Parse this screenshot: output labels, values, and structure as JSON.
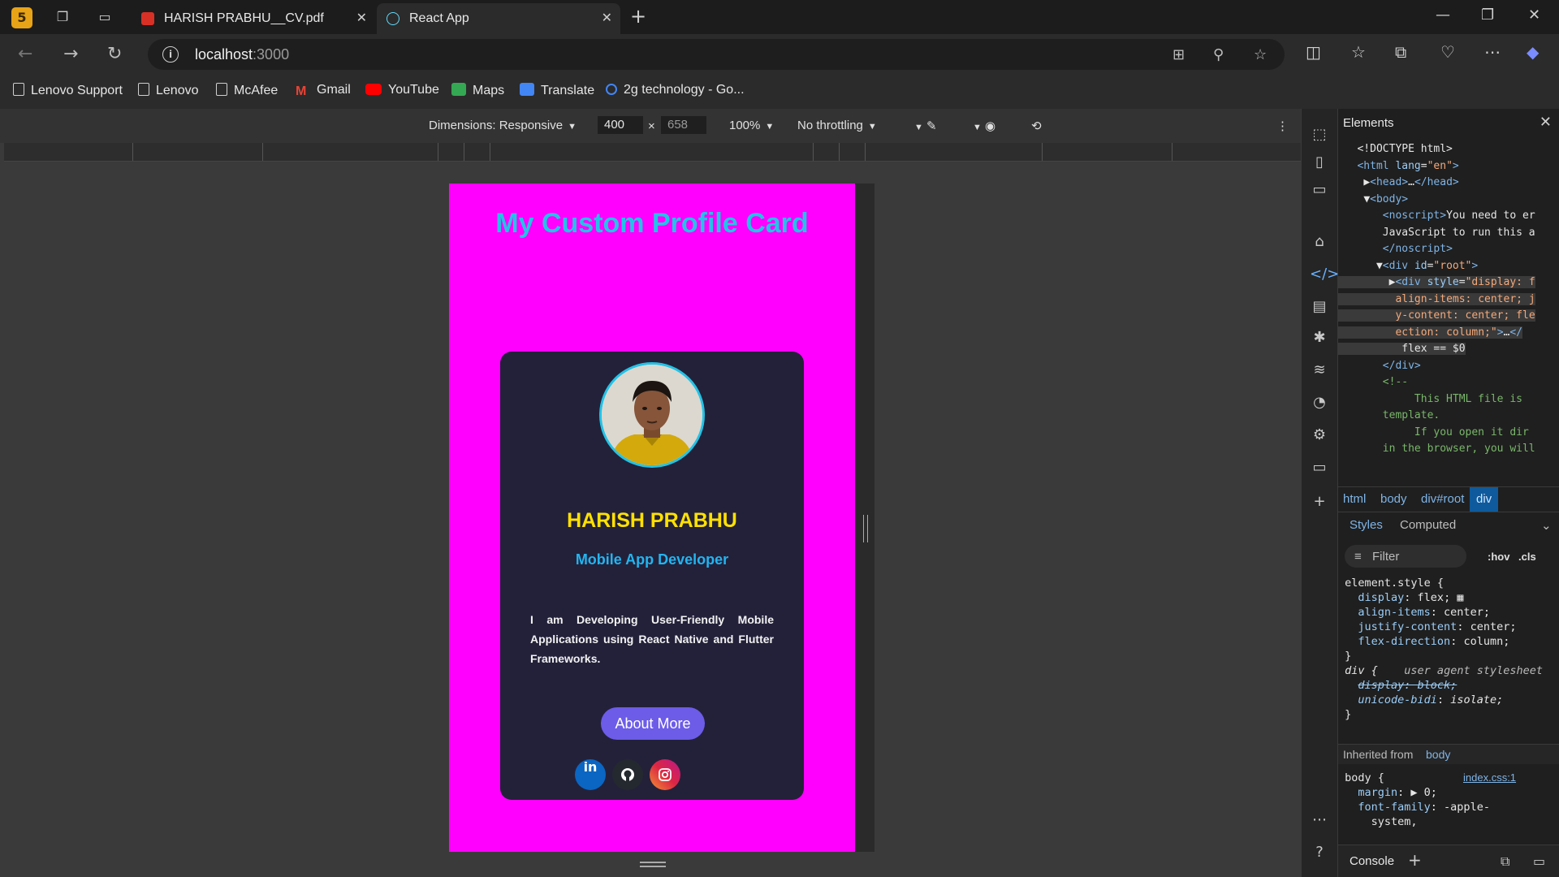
{
  "browser": {
    "tabs": [
      {
        "title": "HARISH PRABHU__CV.pdf"
      },
      {
        "title": "React App"
      }
    ],
    "address": {
      "host": "localhost",
      "port": ":3000"
    },
    "bookmarks": [
      {
        "label": "Lenovo Support"
      },
      {
        "label": "Lenovo"
      },
      {
        "label": "McAfee"
      },
      {
        "label": "Gmail"
      },
      {
        "label": "YouTube"
      },
      {
        "label": "Maps"
      },
      {
        "label": "Translate"
      },
      {
        "label": "2g technology - Go..."
      }
    ]
  },
  "device_toolbar": {
    "dimensions_label": "Dimensions: Responsive",
    "width": "400",
    "height": "658",
    "zoom": "100%",
    "throttling": "No throttling"
  },
  "app": {
    "title": "My Custom Profile Card",
    "name": "HARISH PRABHU",
    "role": "Mobile App Developer",
    "bio": "I am Developing User-Friendly Mobile Applications using React Native and Flutter Frameworks.",
    "button_label": "About More",
    "social": [
      "in",
      "github",
      "instagram"
    ],
    "colors": {
      "page_bg": "#ff00ff",
      "card_bg": "#23213a",
      "title": "#22c3e6",
      "name": "#ffe100",
      "button": "#6c5ce7"
    }
  },
  "devtools": {
    "panel_title": "Elements",
    "breadcrumbs": [
      "html",
      "body",
      "div#root",
      "div"
    ],
    "style_tabs": [
      "Styles",
      "Computed"
    ],
    "filter_placeholder": "Filter",
    "hov": ":hov",
    "cls": ".cls",
    "inherited_label": "Inherited from",
    "inherited_from": "body",
    "css_source": "index.css:1",
    "console_label": "Console"
  }
}
